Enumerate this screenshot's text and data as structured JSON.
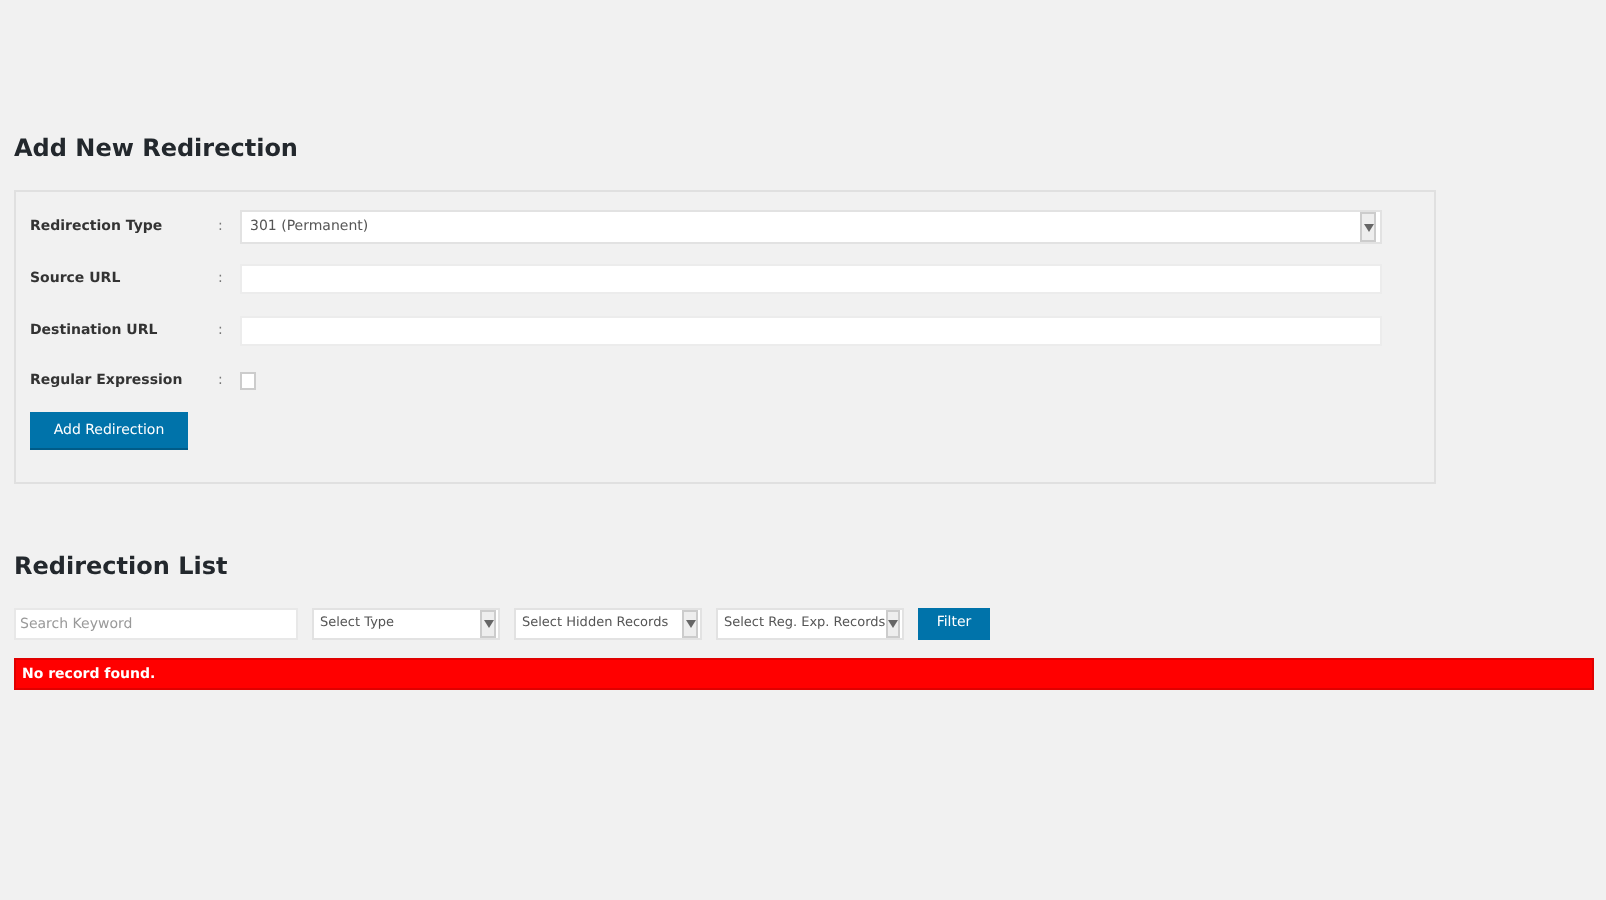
{
  "add_section": {
    "title": "Add New Redirection",
    "fields": [
      {
        "kind": "select",
        "label": "Redirection Type",
        "separator": ":",
        "value": "301 (Permanent)"
      },
      {
        "kind": "text",
        "label": "Source URL",
        "separator": ":"
      },
      {
        "kind": "text",
        "label": "Destination URL",
        "separator": ":"
      },
      {
        "kind": "checkbox",
        "label": "Regular Expression",
        "separator": ":",
        "checked": false
      }
    ],
    "submit_button": "Add Redirection"
  },
  "list_section": {
    "title": "Redirection List",
    "search": {
      "placeholder": "Search Keyword"
    },
    "filters": [
      "Select Type",
      "Select Hidden Records",
      "Select Reg. Exp. Records"
    ],
    "filter_button": "Filter",
    "message": "No record found."
  }
}
